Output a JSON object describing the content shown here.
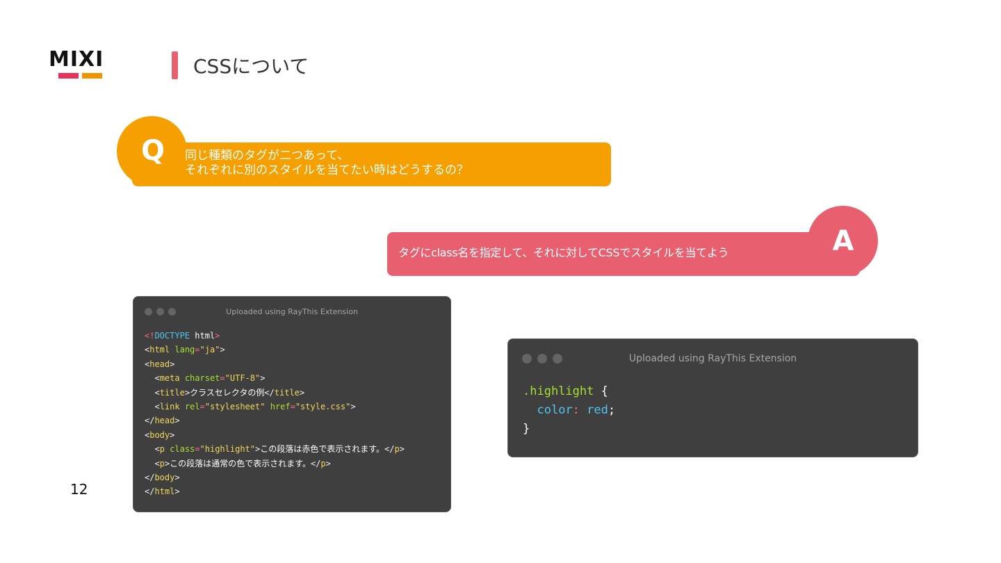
{
  "colors": {
    "accent_red": "#e8606f",
    "accent_orange": "#f5a000",
    "logo_red": "#e8305a",
    "logo_orange": "#f29400",
    "code_bg": "#3f3f3f"
  },
  "logo": {
    "text": "MIXI"
  },
  "title": {
    "text": "CSSについて"
  },
  "question": {
    "letter": "Q",
    "line1": "同じ種類のタグが二つあって、",
    "line2": "それぞれに別のスタイルを当てたい時はどうするの？"
  },
  "answer": {
    "letter": "A",
    "text": "タグにclass名を指定して、それに対してCSSでスタイルを当てよう"
  },
  "html_window": {
    "caption": "Uploaded using RayThis Extension",
    "lines": [
      [
        [
          "punct",
          "<!"
        ],
        [
          "doctype",
          "DOCTYPE"
        ],
        [
          "text",
          " html"
        ],
        [
          "punct",
          ">"
        ]
      ],
      [
        [
          "tag",
          "<"
        ],
        [
          "tagname",
          "html"
        ],
        [
          "text",
          " "
        ],
        [
          "attr",
          "lang"
        ],
        [
          "eq",
          "="
        ],
        [
          "str",
          "\"ja\""
        ],
        [
          "tag",
          ">"
        ]
      ],
      [
        [
          "tag",
          "<"
        ],
        [
          "tagname",
          "head"
        ],
        [
          "tag",
          ">"
        ]
      ],
      [
        [
          "text",
          "  "
        ],
        [
          "tag",
          "<"
        ],
        [
          "tagname",
          "meta"
        ],
        [
          "text",
          " "
        ],
        [
          "attr",
          "charset"
        ],
        [
          "eq",
          "="
        ],
        [
          "str",
          "\"UTF-8\""
        ],
        [
          "tag",
          ">"
        ]
      ],
      [
        [
          "text",
          "  "
        ],
        [
          "tag",
          "<"
        ],
        [
          "tagname",
          "title"
        ],
        [
          "tag",
          ">"
        ],
        [
          "text",
          "クラスセレクタの例"
        ],
        [
          "tag",
          "</"
        ],
        [
          "tagname",
          "title"
        ],
        [
          "tag",
          ">"
        ]
      ],
      [
        [
          "text",
          "  "
        ],
        [
          "tag",
          "<"
        ],
        [
          "tagname",
          "link"
        ],
        [
          "text",
          " "
        ],
        [
          "attr",
          "rel"
        ],
        [
          "eq",
          "="
        ],
        [
          "str",
          "\"stylesheet\""
        ],
        [
          "text",
          " "
        ],
        [
          "attr",
          "href"
        ],
        [
          "eq",
          "="
        ],
        [
          "str",
          "\"style.css\""
        ],
        [
          "tag",
          ">"
        ]
      ],
      [
        [
          "tag",
          "</"
        ],
        [
          "tagname",
          "head"
        ],
        [
          "tag",
          ">"
        ]
      ],
      [
        [
          "tag",
          "<"
        ],
        [
          "tagname",
          "body"
        ],
        [
          "tag",
          ">"
        ]
      ],
      [
        [
          "text",
          "  "
        ],
        [
          "tag",
          "<"
        ],
        [
          "tagname",
          "p"
        ],
        [
          "text",
          " "
        ],
        [
          "attr",
          "class"
        ],
        [
          "eq",
          "="
        ],
        [
          "str",
          "\"highlight\""
        ],
        [
          "tag",
          ">"
        ],
        [
          "text",
          "この段落は赤色で表示されます。"
        ],
        [
          "tag",
          "</"
        ],
        [
          "tagname",
          "p"
        ],
        [
          "tag",
          ">"
        ]
      ],
      [
        [
          "text",
          "  "
        ],
        [
          "tag",
          "<"
        ],
        [
          "tagname",
          "p"
        ],
        [
          "tag",
          ">"
        ],
        [
          "text",
          "この段落は通常の色で表示されます。"
        ],
        [
          "tag",
          "</"
        ],
        [
          "tagname",
          "p"
        ],
        [
          "tag",
          ">"
        ]
      ],
      [
        [
          "tag",
          "</"
        ],
        [
          "tagname",
          "body"
        ],
        [
          "tag",
          ">"
        ]
      ],
      [
        [
          "tag",
          "</"
        ],
        [
          "tagname",
          "html"
        ],
        [
          "tag",
          ">"
        ]
      ]
    ]
  },
  "css_window": {
    "caption": "Uploaded using RayThis Extension",
    "lines": [
      [
        [
          "sel",
          ".highlight"
        ],
        [
          "text",
          " {"
        ]
      ],
      [
        [
          "text",
          "  "
        ],
        [
          "prop",
          "color"
        ],
        [
          "punct",
          ":"
        ],
        [
          "text",
          " "
        ],
        [
          "val",
          "red"
        ],
        [
          "text",
          ";"
        ]
      ],
      [
        [
          "text",
          "}"
        ]
      ]
    ]
  },
  "page_number": "12"
}
